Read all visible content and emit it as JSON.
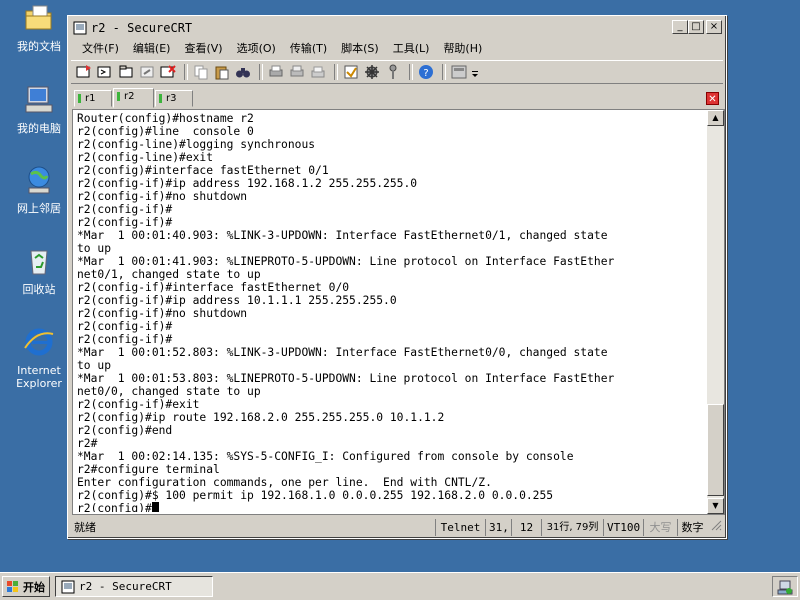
{
  "desktop": {
    "icons": [
      {
        "label": "我的文档",
        "icon": "my-documents-icon"
      },
      {
        "label": "我的电脑",
        "icon": "my-computer-icon"
      },
      {
        "label": "网上邻居",
        "icon": "network-places-icon"
      },
      {
        "label": "回收站",
        "icon": "recycle-bin-icon"
      },
      {
        "label": "Internet Explorer",
        "icon": "internet-explorer-icon"
      }
    ]
  },
  "window": {
    "title": "r2 - SecureCRT",
    "controls": {
      "minimize": "_",
      "maximize": "□",
      "close": "×"
    }
  },
  "menu": [
    "文件(F)",
    "编辑(E)",
    "查看(V)",
    "选项(O)",
    "传输(T)",
    "脚本(S)",
    "工具(L)",
    "帮助(H)"
  ],
  "tabs": [
    {
      "label": "r1",
      "active": false
    },
    {
      "label": "r2",
      "active": true
    },
    {
      "label": "r3",
      "active": false
    }
  ],
  "terminal": {
    "lines": [
      "Router(config)#hostname r2",
      "r2(config)#line  console 0",
      "r2(config-line)#logging synchronous",
      "r2(config-line)#exit",
      "r2(config)#interface fastEthernet 0/1",
      "r2(config-if)#ip address 192.168.1.2 255.255.255.0",
      "r2(config-if)#no shutdown",
      "r2(config-if)#",
      "r2(config-if)#",
      "*Mar  1 00:01:40.903: %LINK-3-UPDOWN: Interface FastEthernet0/1, changed state",
      "to up",
      "*Mar  1 00:01:41.903: %LINEPROTO-5-UPDOWN: Line protocol on Interface FastEther",
      "net0/1, changed state to up",
      "r2(config-if)#interface fastEthernet 0/0",
      "r2(config-if)#ip address 10.1.1.1 255.255.255.0",
      "r2(config-if)#no shutdown",
      "r2(config-if)#",
      "r2(config-if)#",
      "*Mar  1 00:01:52.803: %LINK-3-UPDOWN: Interface FastEthernet0/0, changed state",
      "to up",
      "*Mar  1 00:01:53.803: %LINEPROTO-5-UPDOWN: Line protocol on Interface FastEther",
      "net0/0, changed state to up",
      "r2(config-if)#exit",
      "r2(config)#ip route 192.168.2.0 255.255.255.0 10.1.1.2",
      "r2(config)#end",
      "r2#",
      "*Mar  1 00:02:14.135: %SYS-5-CONFIG_I: Configured from console by console",
      "r2#configure terminal",
      "Enter configuration commands, one per line.  End with CNTL/Z.",
      "r2(config)#$ 100 permit ip 192.168.1.0 0.0.0.255 192.168.2.0 0.0.0.255"
    ],
    "prompt": "r2(config)#"
  },
  "status": {
    "ready": "就绪",
    "protocol": "Telnet",
    "row": "31,",
    "col": "12",
    "rowcol": "31行, 79列",
    "emulation": "VT100",
    "caps": "大写",
    "num": "数字"
  },
  "taskbar": {
    "start_label": "开始",
    "task_label": "r2 - SecureCRT"
  },
  "colors": {
    "desktop": "#3a6ea5",
    "tab_marker": "#3cb43c",
    "tab_close": "#dd3333"
  }
}
